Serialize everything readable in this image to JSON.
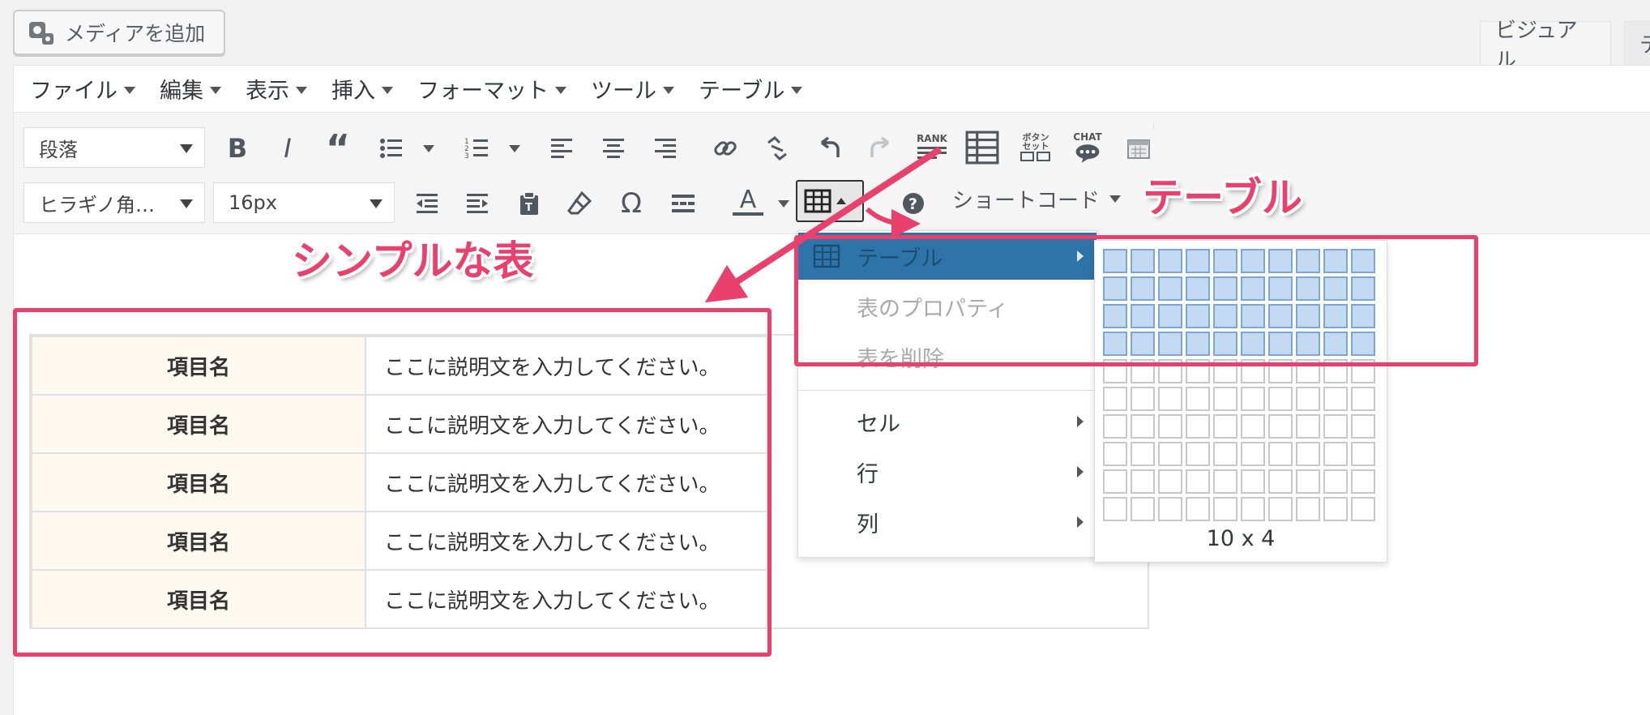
{
  "header": {
    "media_button": "メディアを追加",
    "tabs": [
      "ビジュアル",
      "テ"
    ]
  },
  "menubar": [
    "ファイル",
    "編集",
    "表示",
    "挿入",
    "フォーマット",
    "ツール",
    "テーブル"
  ],
  "toolbar": {
    "paragraph_select": "段落",
    "font_select": "ヒラギノ角…",
    "size_select": "16px",
    "rank_label": "RANK",
    "button_set_label": "ボタン\nセット",
    "chat_label": "CHAT",
    "shortcode_label": "ショートコード"
  },
  "annotations": {
    "simple_table": "シンプルな表",
    "table": "テーブル"
  },
  "table_menu": {
    "items": [
      {
        "label": "テーブル",
        "state": "active",
        "submenu": true
      },
      {
        "label": "表のプロパティ",
        "state": "disabled",
        "submenu": false
      },
      {
        "label": "表を削除",
        "state": "disabled",
        "submenu": false
      },
      {
        "label": "セル",
        "state": "normal",
        "submenu": true
      },
      {
        "label": "行",
        "state": "normal",
        "submenu": true
      },
      {
        "label": "列",
        "state": "normal",
        "submenu": true
      }
    ],
    "grid_columns": 10,
    "grid_rows": 10,
    "selected_columns": 10,
    "selected_rows": 4,
    "grid_label": "10 x 4"
  },
  "content_table": {
    "rows": [
      {
        "head": "項目名",
        "desc": "ここに説明文を入力してください。"
      },
      {
        "head": "項目名",
        "desc": "ここに説明文を入力してください。"
      },
      {
        "head": "項目名",
        "desc": "ここに説明文を入力してください。"
      },
      {
        "head": "項目名",
        "desc": "ここに説明文を入力してください。"
      },
      {
        "head": "項目名",
        "desc": "ここに説明文を入力してください。"
      }
    ]
  },
  "colors": {
    "accent_pink": "#e8416d",
    "menu_active": "#2e74a8",
    "grid_selected": "#c3d8f1"
  }
}
